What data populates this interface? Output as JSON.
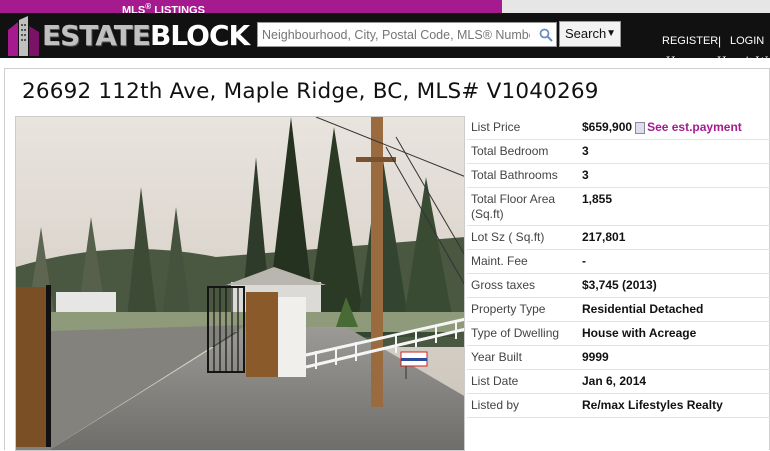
{
  "top_strip": {
    "label": "MLS",
    "reg_mark": "®",
    "suffix": " LISTINGS"
  },
  "brand": {
    "part1": "ESTATE",
    "part2": "BLOCK"
  },
  "search": {
    "placeholder": "Neighbourhood, City, Postal Code, MLS® Numbe",
    "button_label": "Search"
  },
  "nav": {
    "register": "REGISTER",
    "separator": "|",
    "login": "LOGIN",
    "home": "Home",
    "how_it": "How it W"
  },
  "listing": {
    "title": "26692 112th Ave, Maple Ridge, BC, MLS# V1040269",
    "price_label": "List Price",
    "price_value": "$659,900",
    "payment_link": "See est.payment",
    "rows": [
      {
        "label": "Total Bedroom",
        "value": "3"
      },
      {
        "label": "Total Bathrooms",
        "value": "3"
      },
      {
        "label": "Total Floor Area (Sq.ft)",
        "value": "1,855"
      },
      {
        "label": "Lot Sz ( Sq.ft)",
        "value": "217,801"
      },
      {
        "label": "Maint. Fee",
        "value": "-"
      },
      {
        "label": "Gross taxes",
        "value": "$3,745 (2013)"
      },
      {
        "label": "Property Type",
        "value": "Residential Detached"
      },
      {
        "label": "Type of Dwelling",
        "value": "House with Acreage"
      },
      {
        "label": "Year Built",
        "value": "9999"
      },
      {
        "label": "List Date",
        "value": "Jan 6, 2014"
      },
      {
        "label": "Listed by",
        "value": "Re/max Lifestyles Realty"
      }
    ]
  },
  "colors": {
    "brand_purple": "#a51a8f",
    "header_black": "#111111"
  }
}
